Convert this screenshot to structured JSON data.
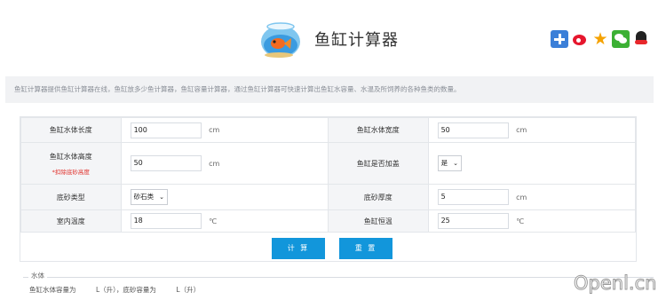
{
  "header": {
    "title": "鱼缸计算器",
    "logo_icon": "fishbowl-icon",
    "share_icons": [
      "plus-share-icon",
      "weibo-icon",
      "star-icon",
      "wechat-icon",
      "qq-icon"
    ]
  },
  "description": "鱼缸计算器提供鱼缸计算器在线，鱼缸放多少鱼计算器，鱼缸容量计算器，通过鱼缸计算器可快速计算出鱼缸水容量、水温及所饲养的各种鱼类的数量。",
  "form": {
    "rows": [
      {
        "left": {
          "label": "鱼缸水体长度",
          "value": "100",
          "unit": "cm"
        },
        "right": {
          "label": "鱼缸水体宽度",
          "value": "50",
          "unit": "cm"
        }
      },
      {
        "left": {
          "label": "鱼缸水体高度",
          "note": "*扣除底砂高度",
          "value": "50",
          "unit": "cm"
        },
        "right": {
          "label": "鱼缸是否加盖",
          "select": "是"
        }
      },
      {
        "left": {
          "label": "底砂类型",
          "select": "砂石类"
        },
        "right": {
          "label": "底砂厚度",
          "value": "5",
          "unit": "cm"
        }
      },
      {
        "left": {
          "label": "室内温度",
          "value": "18",
          "unit": "℃"
        },
        "right": {
          "label": "鱼缸恒温",
          "value": "25",
          "unit": "℃"
        }
      }
    ],
    "buttons": {
      "calc": "计 算",
      "reset": "重 置"
    }
  },
  "result": {
    "legend": "水体",
    "line": "鱼缸水体容量为　　　L（升），底砂容量为　　　L（升）"
  },
  "watermark": "Openl.cn",
  "colors": {
    "button": "#1296db",
    "note": "#e0302b",
    "label_bg": "#f4f5f7"
  }
}
